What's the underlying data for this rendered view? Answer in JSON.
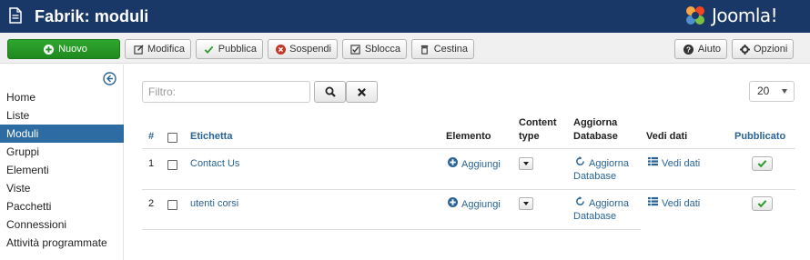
{
  "header": {
    "title": "Fabrik: moduli",
    "logo_text": "Joomla!"
  },
  "toolbar": {
    "new_label": "Nuovo",
    "edit_label": "Modifica",
    "publish_label": "Pubblica",
    "unpublish_label": "Sospendi",
    "checkin_label": "Sblocca",
    "trash_label": "Cestina",
    "help_label": "Aiuto",
    "options_label": "Opzioni"
  },
  "sidebar": {
    "items": [
      {
        "label": "Home",
        "active": false
      },
      {
        "label": "Liste",
        "active": false
      },
      {
        "label": "Moduli",
        "active": true
      },
      {
        "label": "Gruppi",
        "active": false
      },
      {
        "label": "Elementi",
        "active": false
      },
      {
        "label": "Viste",
        "active": false
      },
      {
        "label": "Pacchetti",
        "active": false
      },
      {
        "label": "Connessioni",
        "active": false
      },
      {
        "label": "Attività programmate",
        "active": false
      }
    ]
  },
  "filter": {
    "placeholder": "Filtro:",
    "limit_value": "20"
  },
  "table": {
    "headers": {
      "num": "#",
      "label": "Etichetta",
      "element": "Elemento",
      "content_type_1": "Content",
      "content_type_2": "type",
      "update_db_1": "Aggiorna",
      "update_db_2": "Database",
      "view_data": "Vedi dati",
      "published": "Pubblicato"
    },
    "rows": [
      {
        "num": "1",
        "label": "Contact Us",
        "element_action": "Aggiungi",
        "update_1": "Aggiorna",
        "update_2": "Database",
        "view_data": "Vedi dati",
        "published": true
      },
      {
        "num": "2",
        "label": "utenti corsi",
        "element_action": "Aggiungi",
        "update_1": "Aggiorna",
        "update_2": "Database",
        "view_data": "Vedi dati",
        "published": true
      }
    ]
  },
  "colors": {
    "header_bg": "#1a3867",
    "new_button": "#2fa62f",
    "active_sidebar": "#2d6ca2",
    "link": "#2a6496",
    "published_check": "#2e9b2e"
  }
}
